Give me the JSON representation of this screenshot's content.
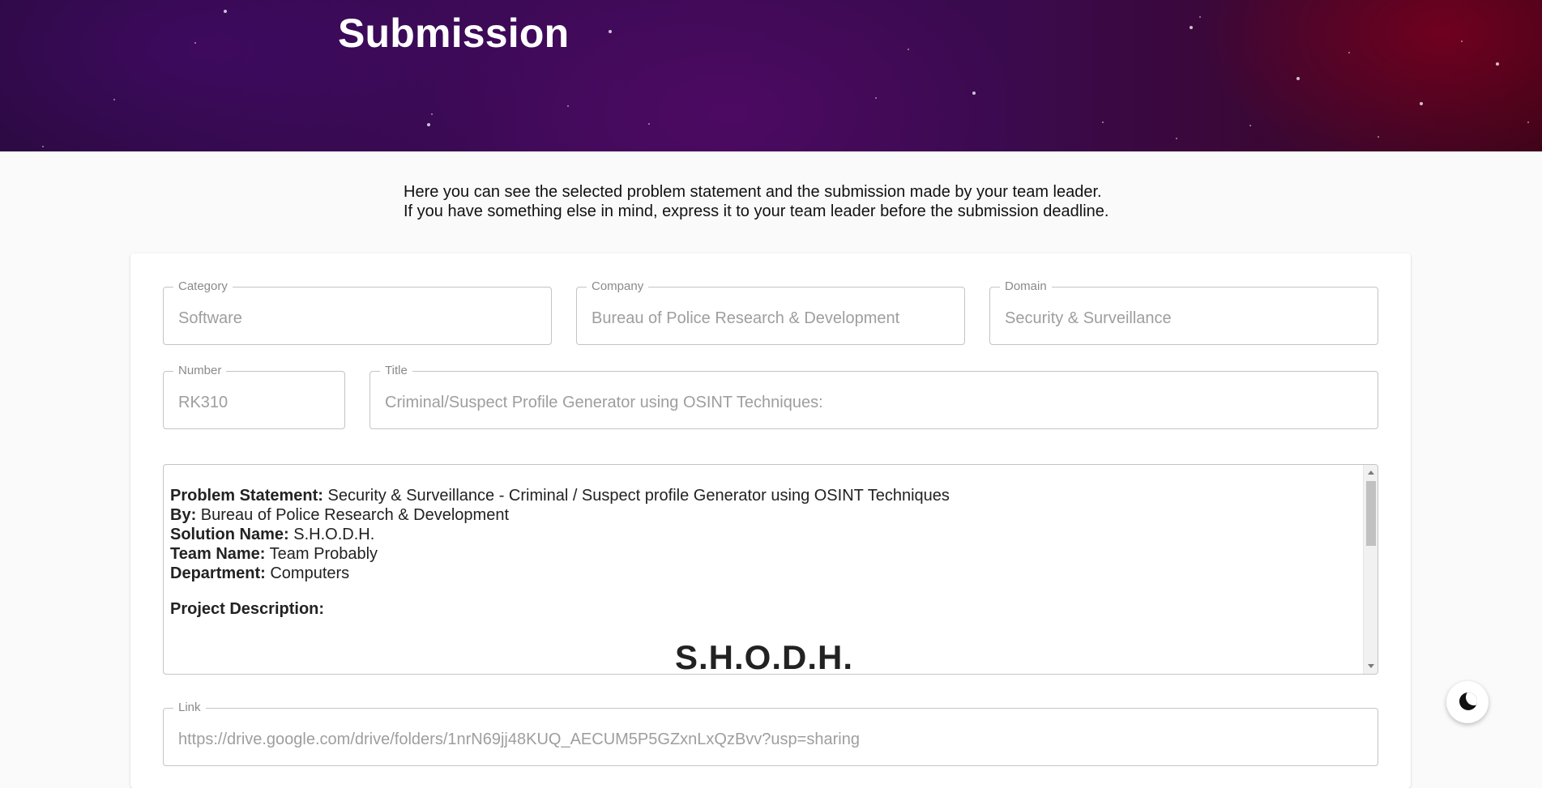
{
  "header": {
    "title": "Submission"
  },
  "intro": {
    "line1": "Here you can see the selected problem statement and the submission made by your team leader.",
    "line2": "If you have something else in mind, express it to your team leader before the submission deadline."
  },
  "fields": {
    "category": {
      "label": "Category",
      "value": "Software"
    },
    "company": {
      "label": "Company",
      "value": "Bureau of Police Research & Development"
    },
    "domain": {
      "label": "Domain",
      "value": "Security & Surveillance"
    },
    "number": {
      "label": "Number",
      "value": "RK310"
    },
    "title": {
      "label": "Title",
      "value": "Criminal/Suspect Profile Generator using OSINT Techniques:"
    },
    "link": {
      "label": "Link",
      "value": "https://drive.google.com/drive/folders/1nrN69jj48KUQ_AECUM5P5GZxnLxQzBvv?usp=sharing"
    }
  },
  "editor": {
    "problem_statement_label": "Problem Statement:",
    "problem_statement_value": "Security & Surveillance - Criminal / Suspect profile Generator using OSINT Techniques",
    "by_label": "By:",
    "by_value": "Bureau of Police Research & Development",
    "solution_name_label": "Solution Name:",
    "solution_name_value": "S.H.O.D.H.",
    "team_name_label": "Team Name:",
    "team_name_value": "Team Probably",
    "department_label": "Department:",
    "department_value": "Computers",
    "project_description_label": "Project Description:",
    "heading": "S.H.O.D.H."
  },
  "theme_toggle": {
    "icon": "moon-icon"
  },
  "colors": {
    "hero_left": "#2a0a3f",
    "hero_right": "#3a0418",
    "field_border": "#c4c4c4",
    "field_value": "#9e9e9e"
  }
}
